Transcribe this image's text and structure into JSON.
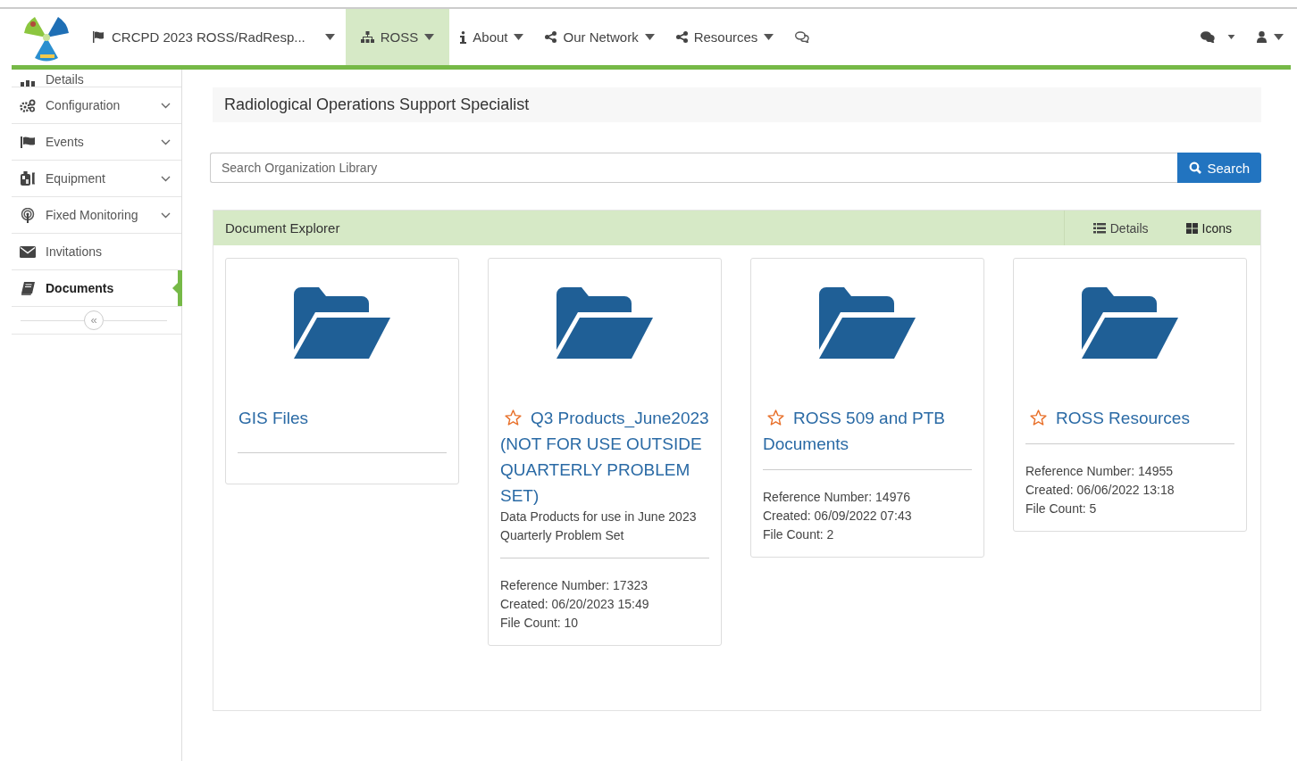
{
  "nav": {
    "items": [
      {
        "label": "CRCPD 2023 ROSS/RadResp...",
        "selected": false
      },
      {
        "label": "ROSS",
        "selected": true
      },
      {
        "label": "About",
        "selected": false
      },
      {
        "label": "Our Network",
        "selected": false
      },
      {
        "label": "Resources",
        "selected": false
      }
    ]
  },
  "sidebar": {
    "items": [
      {
        "label": "Details",
        "expandable": false,
        "selected": false
      },
      {
        "label": "Configuration",
        "expandable": true,
        "selected": false
      },
      {
        "label": "Events",
        "expandable": true,
        "selected": false
      },
      {
        "label": "Equipment",
        "expandable": true,
        "selected": false
      },
      {
        "label": "Fixed Monitoring",
        "expandable": true,
        "selected": false
      },
      {
        "label": "Invitations",
        "expandable": false,
        "selected": false
      },
      {
        "label": "Documents",
        "expandable": false,
        "selected": true
      }
    ],
    "collapse": "«"
  },
  "page_title": "Radiological Operations Support Specialist",
  "search": {
    "placeholder": "Search Organization Library",
    "button": "Search"
  },
  "explorer": {
    "title": "Document Explorer",
    "views": [
      {
        "label": "Details",
        "selected": false
      },
      {
        "label": "Icons",
        "selected": true
      }
    ],
    "cards": [
      {
        "title": "GIS Files"
      },
      {
        "title": "Q3 Products_June2023 (NOT FOR USE OUTSIDE QUARTERLY PROBLEM SET)",
        "starred": false,
        "description": "Data Products for use in June 2023 Quarterly Problem Set",
        "reference": "Reference Number: 17323",
        "created": "Created: 06/20/2023 15:49",
        "file_count": "File Count: 10"
      },
      {
        "title": "ROSS 509 and PTB Documents",
        "starred": false,
        "reference": "Reference Number: 14976",
        "created": "Created: 06/09/2022 07:43",
        "file_count": "File Count: 2"
      },
      {
        "title": "ROSS Resources",
        "starred": false,
        "reference": "Reference Number: 14955",
        "created": "Created: 06/06/2022 13:18",
        "file_count": "File Count: 5"
      }
    ]
  }
}
